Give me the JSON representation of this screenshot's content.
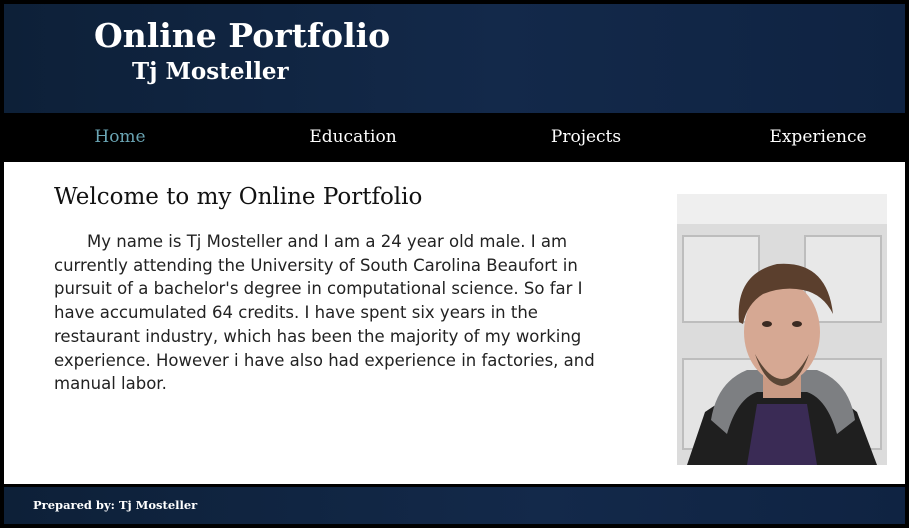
{
  "header": {
    "title": "Online Portfolio",
    "subtitle": "Tj Mosteller"
  },
  "nav": {
    "items": [
      {
        "label": "Home",
        "active": true
      },
      {
        "label": "Education",
        "active": false
      },
      {
        "label": "Projects",
        "active": false
      },
      {
        "label": "Experience",
        "active": false
      }
    ]
  },
  "main": {
    "heading": "Welcome to my Online Portfolio",
    "bio": "My name is Tj Mosteller and I am a 24 year old male. I am currently attending the University of South Carolina Beaufort in pursuit of a bachelor's degree in computational science. So far I have accumulated 64 credits. I have spent six years in the restaurant industry, which has been the majority of my working experience. However i have also had experience in factories, and manual labor.",
    "photo_icon": "profile-photo"
  },
  "footer": {
    "prepared_by": "Prepared by: Tj Mosteller"
  },
  "colors": {
    "header_bg": "#13294a",
    "nav_bg": "#000000",
    "nav_active": "#6aa5b4",
    "text": "#222222"
  }
}
